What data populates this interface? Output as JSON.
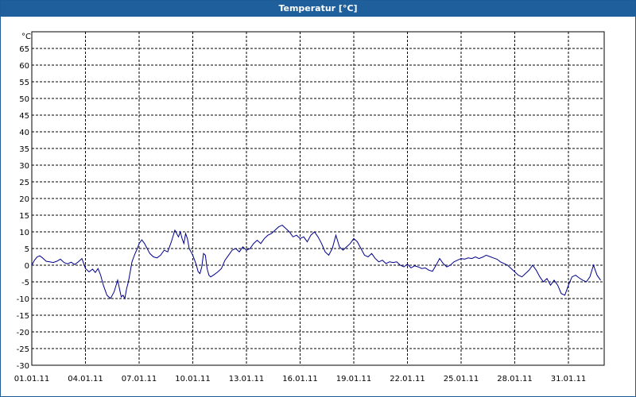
{
  "window": {
    "title": "Temperatur [°C]"
  },
  "chart_data": {
    "type": "line",
    "title": "Temperatur [°C]",
    "xlabel": "",
    "ylabel": "°C",
    "ylim": [
      -30,
      70
    ],
    "grid": true,
    "y_ticks": [
      "65",
      "60",
      "55",
      "50",
      "45",
      "40",
      "35",
      "30",
      "25",
      "20",
      "15",
      "10",
      "5",
      "0",
      "-5",
      "-10",
      "-15",
      "-20",
      "-25",
      "-30"
    ],
    "x_ticks": [
      "01.01.11",
      "04.01.11",
      "07.01.11",
      "10.01.11",
      "13.01.11",
      "16.01.11",
      "19.01.11",
      "22.01.11",
      "25.01.11",
      "28.01.11",
      "31.01.11"
    ],
    "line_color": "#00008b",
    "series": [
      {
        "x": [
          0,
          0.15,
          0.3,
          0.45,
          0.6,
          0.8,
          1.0,
          1.2,
          1.4,
          1.6,
          1.8,
          2.0,
          2.2,
          2.4,
          2.6,
          2.8,
          3.0,
          3.2,
          3.4,
          3.55,
          3.7,
          3.85,
          4.0,
          4.2,
          4.4,
          4.6,
          4.8,
          5.0,
          5.1,
          5.2,
          5.3,
          5.4,
          5.5,
          5.6,
          5.7,
          5.8,
          5.9,
          6.0,
          6.15,
          6.3,
          6.45,
          6.6,
          6.8,
          7.0,
          7.2,
          7.4,
          7.6,
          7.8,
          8.0,
          8.2,
          8.3,
          8.4,
          8.5,
          8.6,
          8.7,
          8.8,
          8.9,
          9.0,
          9.1,
          9.2,
          9.3,
          9.4,
          9.5,
          9.6,
          9.7,
          9.8,
          9.9,
          10.0,
          10.2,
          10.4,
          10.6,
          10.8,
          11.0,
          11.2,
          11.4,
          11.6,
          11.8,
          12.0,
          12.2,
          12.4,
          12.6,
          12.8,
          13.0,
          13.2,
          13.4,
          13.6,
          13.8,
          14.0,
          14.2,
          14.4,
          14.6,
          14.8,
          15.0,
          15.2,
          15.4,
          15.6,
          15.8,
          16.0,
          16.2,
          16.4,
          16.6,
          16.8,
          17.0,
          17.2,
          17.4,
          17.6,
          17.8,
          18.0,
          18.2,
          18.4,
          18.6,
          18.8,
          19.0,
          19.2,
          19.4,
          19.6,
          19.8,
          20.0,
          20.2,
          20.4,
          20.6,
          20.8,
          21.0,
          21.2,
          21.4,
          21.6,
          21.8,
          22.0,
          22.2,
          22.4,
          22.6,
          22.8,
          23.0,
          23.2,
          23.4,
          23.6,
          23.8,
          24.0,
          24.2,
          24.4,
          24.6,
          24.8,
          25.0,
          25.2,
          25.4,
          25.6,
          25.8,
          26.0,
          26.2,
          26.4,
          26.6,
          26.8,
          27.0,
          27.2,
          27.4,
          27.6,
          27.8,
          28.0,
          28.2,
          28.4,
          28.6,
          28.8,
          29.0,
          29.2,
          29.4,
          29.6,
          29.8,
          30.0,
          30.2,
          30.4,
          30.6,
          30.8,
          31.0,
          31.2,
          31.4,
          31.6,
          31.8
        ],
        "y": [
          0,
          1.5,
          2.5,
          2.8,
          2.2,
          1.2,
          1.0,
          0.8,
          1.2,
          1.8,
          0.8,
          0.4,
          0.9,
          0.2,
          1.0,
          2.0,
          -1.0,
          -2.0,
          -1.2,
          -2.2,
          -1.0,
          -3.0,
          -6.0,
          -9.0,
          -10.0,
          -8.0,
          -4.5,
          -9.5,
          -9.0,
          -10.0,
          -7.0,
          -5.0,
          -2.0,
          1.0,
          2.5,
          3.8,
          5.0,
          6.5,
          7.6,
          6.5,
          5.0,
          3.5,
          2.5,
          2.2,
          3.0,
          4.5,
          4.0,
          7.0,
          10.5,
          8.5,
          10.0,
          8.0,
          6.5,
          9.5,
          8.0,
          5.0,
          4.0,
          3.0,
          1.5,
          0.0,
          -2.0,
          -2.5,
          -0.5,
          3.5,
          3.0,
          -1.0,
          -3.0,
          -3.5,
          -2.8,
          -2.0,
          -1.0,
          1.5,
          3.0,
          4.5,
          5.0,
          4.0,
          5.5,
          4.5,
          5.0,
          6.5,
          7.5,
          6.5,
          8.0,
          9.0,
          9.5,
          10.5,
          11.5,
          12.0,
          11.0,
          10.0,
          8.5,
          9.0,
          8.0,
          8.5,
          7.0,
          9.0,
          10.0,
          8.5,
          6.5,
          4.0,
          3.0,
          5.0,
          9.0,
          5.5,
          4.5,
          5.5,
          6.5,
          8.0,
          7.0,
          5.0,
          3.0,
          2.5,
          3.5,
          2.0,
          1.0,
          1.5,
          0.5,
          1.0,
          0.8,
          1.0,
          0.0,
          -0.5,
          0.3,
          -0.8,
          -0.2,
          -0.5,
          -1.0,
          -0.8,
          -1.5,
          -1.8,
          0.0,
          2.0,
          0.5,
          -0.5,
          0.0,
          1.0,
          1.5,
          2.0,
          1.8,
          2.2,
          2.0,
          2.5,
          2.0,
          2.4,
          3.0,
          2.6,
          2.2,
          1.8,
          1.0,
          0.5,
          0.0,
          -1.0,
          -2.0,
          -3.0,
          -3.5,
          -2.5,
          -1.5,
          0.0,
          -1.5,
          -3.5,
          -5.0,
          -4.0,
          -6.0,
          -4.5,
          -6.0,
          -8.5,
          -9.0,
          -6.0,
          -3.5,
          -3.0,
          -3.8,
          -4.5,
          -5.0,
          -3.5,
          0.0,
          -3.0,
          -4.5
        ]
      }
    ]
  }
}
